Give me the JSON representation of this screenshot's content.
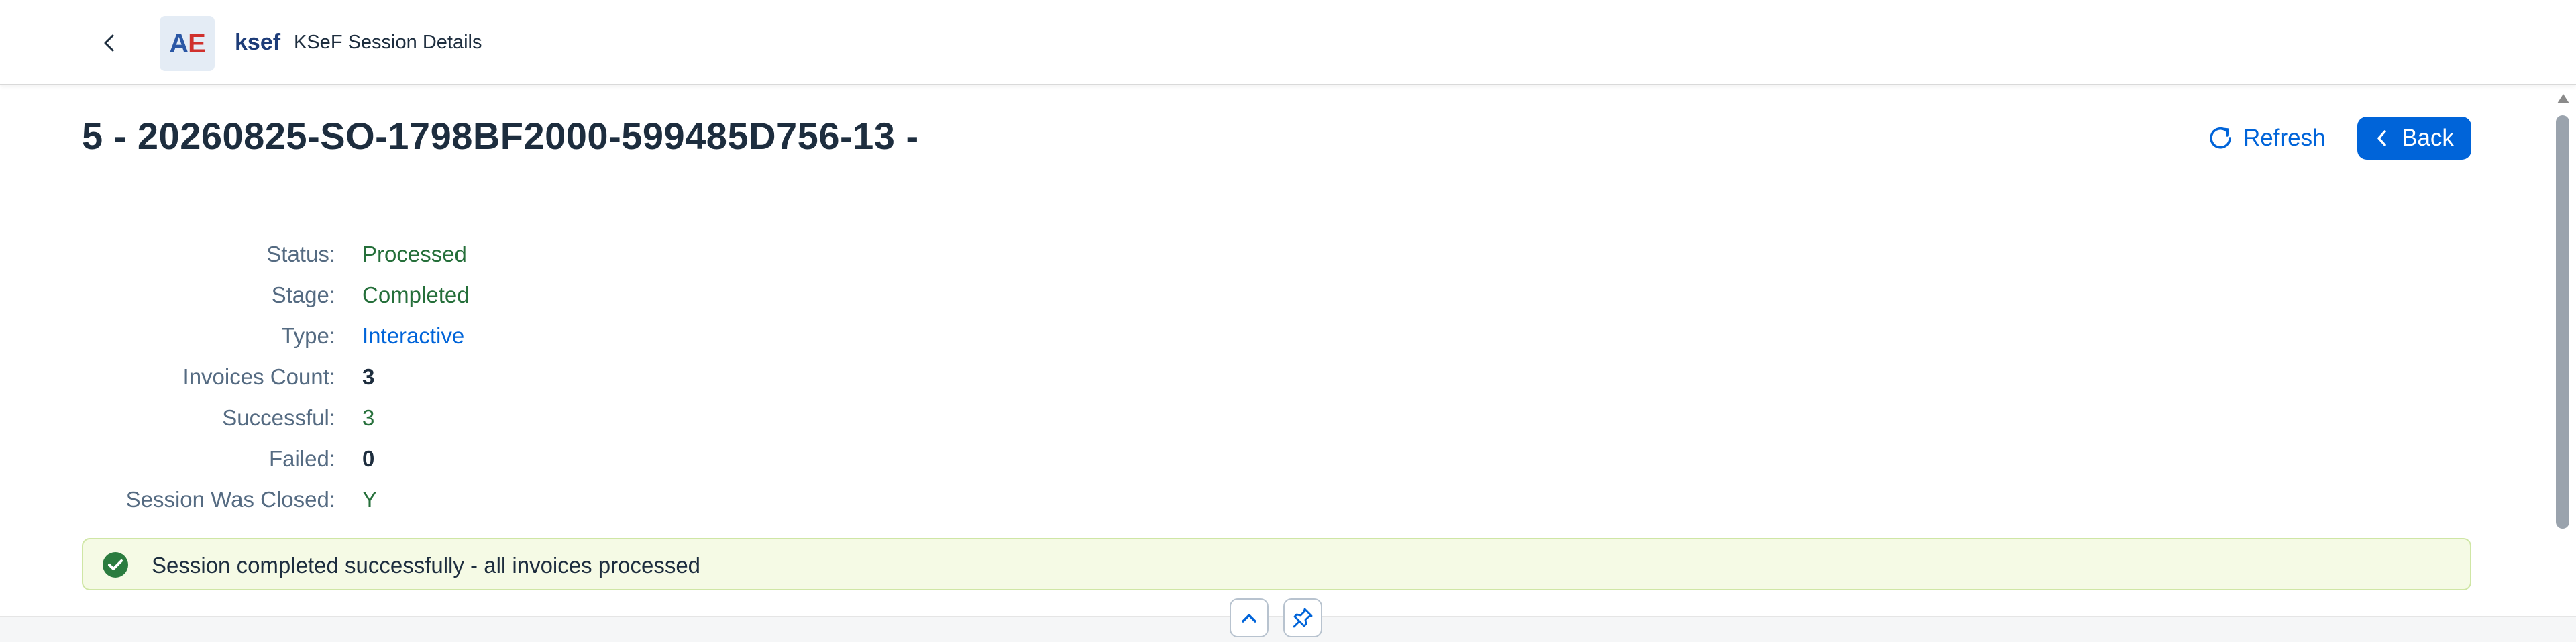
{
  "shell": {
    "logo_a": "A",
    "logo_e": "E",
    "app_name": "ksef",
    "app_title": "KSeF Session Details",
    "icons": [
      "back-chevron-icon",
      "user-settings-icon",
      "analytics-icon",
      "devices-icon",
      "globe-icon",
      "theme-icon",
      "app-grid-icon"
    ]
  },
  "header": {
    "title": "5 - 20260825-SO-1798BF2000-599485D756-13 -",
    "refresh_label": "Refresh",
    "back_label": "Back"
  },
  "details": [
    {
      "label": "Status:",
      "value": "Processed"
    },
    {
      "label": "Stage:",
      "value": "Completed"
    },
    {
      "label": "Type:",
      "value": "Interactive"
    },
    {
      "label": "Invoices Count:",
      "value": "3"
    },
    {
      "label": "Successful:",
      "value": "3"
    },
    {
      "label": "Failed:",
      "value": "0"
    },
    {
      "label": "Session Was Closed:",
      "value": "Y"
    }
  ],
  "message": {
    "type": "success",
    "text": "Session completed successfully - all invoices processed"
  },
  "colors": {
    "accent": "#0064d9",
    "positive": "#256f3a",
    "success_strip_bg": "#f5fae5"
  }
}
